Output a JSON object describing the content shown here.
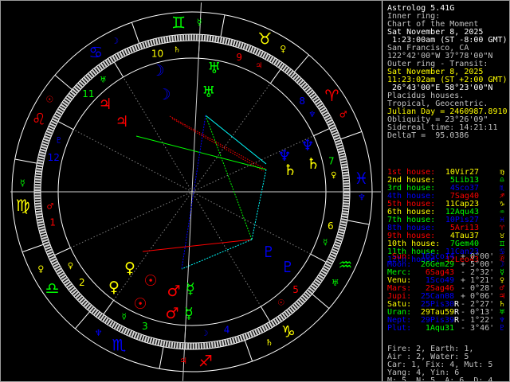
{
  "info": [
    {
      "text": "Astrolog 5.41G",
      "color": "#ffffff"
    },
    {
      "text": "Inner ring:",
      "color": "#c0c0c0"
    },
    {
      "text": "Chart of the Moment",
      "color": "#c0c0c0"
    },
    {
      "text": "Sat November 8, 2025",
      "color": "#ffffff"
    },
    {
      "text": " 1:23:00am (ST -8:00 GMT)",
      "color": "#ffffff"
    },
    {
      "text": "San Francisco, CA",
      "color": "#c0c0c0"
    },
    {
      "text": "122°42'00\"W 37°78'00\"N",
      "color": "#c0c0c0"
    },
    {
      "text": "Outer ring - Transit:",
      "color": "#c0c0c0"
    },
    {
      "text": "Sat November 8, 2025",
      "color": "#ffff00"
    },
    {
      "text": "11:23:02am (ST +2:00 GMT)",
      "color": "#ffff00"
    },
    {
      "text": " 26°43'00\"E 58°23'00\"N",
      "color": "#ffffff"
    },
    {
      "text": "Placidus houses.",
      "color": "#c0c0c0"
    },
    {
      "text": "Tropical, Geocentric.",
      "color": "#c0c0c0"
    },
    {
      "text": "Julian Day = 2460987.8910",
      "color": "#ffff00"
    },
    {
      "text": "Obliquity = 23°26'09\"",
      "color": "#c0c0c0"
    },
    {
      "text": "Sidereal time: 14:21:11",
      "color": "#c0c0c0"
    },
    {
      "text": "DeltaT =  95.0386",
      "color": "#c0c0c0"
    }
  ],
  "houses": [
    {
      "label": "1st house:",
      "value": "10Vir27",
      "glyph": "♍",
      "house_color": "#ff0000",
      "sign_color": "#ffff00"
    },
    {
      "label": "2nd house:",
      "value": "5Lib13",
      "glyph": "♎",
      "house_color": "#ffff00",
      "sign_color": "#00ff00"
    },
    {
      "label": "3rd house:",
      "value": "4Sco37",
      "glyph": "♏",
      "house_color": "#00ff00",
      "sign_color": "#0000ff"
    },
    {
      "label": "4th house:",
      "value": "7Sag40",
      "glyph": "♐",
      "house_color": "#0000ff",
      "sign_color": "#ff0000"
    },
    {
      "label": "5th house:",
      "value": "11Cap23",
      "glyph": "♑",
      "house_color": "#ff0000",
      "sign_color": "#ffff00"
    },
    {
      "label": "6th house:",
      "value": "12Aqu43",
      "glyph": "♒",
      "house_color": "#ffff00",
      "sign_color": "#00ff00"
    },
    {
      "label": "7th house:",
      "value": "10Pis27",
      "glyph": "♓",
      "house_color": "#00ff00",
      "sign_color": "#0000ff"
    },
    {
      "label": "8th house:",
      "value": "5Ari13",
      "glyph": "♈",
      "house_color": "#0000ff",
      "sign_color": "#ff0000"
    },
    {
      "label": "9th house:",
      "value": "4Tau37",
      "glyph": "♉",
      "house_color": "#ff0000",
      "sign_color": "#ffff00"
    },
    {
      "label": "10th house:",
      "value": "7Gem40",
      "glyph": "♊",
      "house_color": "#ffff00",
      "sign_color": "#00ff00"
    },
    {
      "label": "11th house:",
      "value": "11Can23",
      "glyph": "♋",
      "house_color": "#00ff00",
      "sign_color": "#0000ff"
    },
    {
      "label": "12th house:",
      "value": "12Leo43",
      "glyph": "♌",
      "house_color": "#0000ff",
      "sign_color": "#ff0000"
    }
  ],
  "planets": [
    {
      "name": "Sun:",
      "value": "16Sco14",
      "retro": "",
      "aspect": "+ 0°00'",
      "glyph": "☉",
      "color": "#ff0000",
      "sign_color": "#0000ff"
    },
    {
      "name": "Moon:",
      "value": "26Gem29",
      "retro": "",
      "aspect": "+ 5°00'",
      "glyph": "☽",
      "color": "#0000ff",
      "sign_color": "#00ff00"
    },
    {
      "name": "Merc:",
      "value": "6Sag43",
      "retro": "",
      "aspect": "- 2°32'",
      "glyph": "☿",
      "color": "#00ff00",
      "sign_color": "#ff0000"
    },
    {
      "name": "Venu:",
      "value": "1Sco49",
      "retro": "",
      "aspect": "+ 1°21'",
      "glyph": "♀",
      "color": "#ffff00",
      "sign_color": "#0000ff"
    },
    {
      "name": "Mars:",
      "value": "2Sag46",
      "retro": "",
      "aspect": "- 0°28'",
      "glyph": "♂",
      "color": "#ff0000",
      "sign_color": "#ff0000"
    },
    {
      "name": "Jupi:",
      "value": "25Can08",
      "retro": "",
      "aspect": "+ 0°06'",
      "glyph": "♃",
      "color": "#ff0000",
      "sign_color": "#0000ff"
    },
    {
      "name": "Satu:",
      "value": "25Pis30",
      "retro": "R",
      "aspect": "- 2°27'",
      "glyph": "♄",
      "color": "#ffff00",
      "sign_color": "#0000ff"
    },
    {
      "name": "Uran:",
      "value": "29Tau59",
      "retro": "R",
      "aspect": "- 0°13'",
      "glyph": "♅",
      "color": "#00ff00",
      "sign_color": "#ffff00"
    },
    {
      "name": "Nept:",
      "value": "29Pis39",
      "retro": "R",
      "aspect": "- 1°22'",
      "glyph": "♆",
      "color": "#0000ff",
      "sign_color": "#0000ff"
    },
    {
      "name": "Plut:",
      "value": "1Aqu31",
      "retro": "",
      "aspect": "- 3°46'",
      "glyph": "♇",
      "color": "#0000ff",
      "sign_color": "#00ff00"
    }
  ],
  "elements": [
    "Fire: 2, Earth: 1,",
    "Air : 2, Water: 5",
    "Car: 1, Fix: 4, Mut: 5",
    "Yang: 4, Yin: 6",
    "M: 5, N: 5, A: 6, D: 4"
  ],
  "chart_data": {
    "type": "astrology-biwheel",
    "ascendant_deg": 160.45,
    "house_cusps_deg": [
      160.45,
      185.22,
      214.62,
      247.67,
      281.38,
      312.72,
      340.45,
      5.22,
      34.62,
      67.67,
      101.38,
      132.72
    ],
    "house_numbers": [
      "1",
      "2",
      "3",
      "4",
      "5",
      "6",
      "7",
      "8",
      "9",
      "10",
      "11",
      "12"
    ],
    "house_number_colors": [
      "#ff0000",
      "#ffff00",
      "#00ff00",
      "#0000ff",
      "#ff0000",
      "#ffff00",
      "#00ff00",
      "#0000ff",
      "#ff0000",
      "#ffff00",
      "#00ff00",
      "#0000ff"
    ],
    "signs": [
      {
        "glyph": "♈",
        "color": "#ff0000"
      },
      {
        "glyph": "♉",
        "color": "#ffff00"
      },
      {
        "glyph": "♊",
        "color": "#00ff00"
      },
      {
        "glyph": "♋",
        "color": "#0000ff"
      },
      {
        "glyph": "♌",
        "color": "#ff0000"
      },
      {
        "glyph": "♍",
        "color": "#ffff00"
      },
      {
        "glyph": "♎",
        "color": "#00ff00"
      },
      {
        "glyph": "♏",
        "color": "#0000ff"
      },
      {
        "glyph": "♐",
        "color": "#ff0000"
      },
      {
        "glyph": "♑",
        "color": "#ffff00"
      },
      {
        "glyph": "♒",
        "color": "#00ff00"
      },
      {
        "glyph": "♓",
        "color": "#0000ff"
      }
    ],
    "outer_markers": [
      {
        "glyph": "☿",
        "deg": 68,
        "color": "#00ff00"
      },
      {
        "glyph": "♀",
        "deg": 38,
        "color": "#ffff00"
      },
      {
        "glyph": "☽",
        "deg": 97.5,
        "color": "#0000ff"
      },
      {
        "glyph": "☉",
        "deg": 127.5,
        "color": "#ff0000"
      },
      {
        "glyph": "♂",
        "deg": 7.5,
        "color": "#ff0000"
      },
      {
        "glyph": "☿",
        "deg": 157.5,
        "color": "#00ff00"
      },
      {
        "glyph": "♀",
        "deg": 187.5,
        "color": "#ffff00"
      },
      {
        "glyph": "♆",
        "deg": 217,
        "color": "#0000ff"
      },
      {
        "glyph": "♃",
        "deg": 247.5,
        "color": "#ff0000"
      },
      {
        "glyph": "♄",
        "deg": 277.5,
        "color": "#ffff00"
      },
      {
        "glyph": "♅",
        "deg": 308,
        "color": "#00ff00"
      },
      {
        "glyph": "♆",
        "deg": 338.5,
        "color": "#0000ff"
      }
    ],
    "inner_markers": [
      {
        "glyph": "♄",
        "deg": 76.5,
        "color": "#ffff00"
      },
      {
        "glyph": "♃",
        "deg": 42.5,
        "color": "#ff0000"
      },
      {
        "glyph": "♅",
        "deg": 109,
        "color": "#00ff00"
      },
      {
        "glyph": "♇",
        "deg": 139.5,
        "color": "#0000ff"
      },
      {
        "glyph": "♂",
        "deg": 166.5,
        "color": "#ff0000"
      },
      {
        "glyph": "♀",
        "deg": 192,
        "color": "#ffff00"
      },
      {
        "glyph": "☿",
        "deg": 222,
        "color": "#00ff00"
      },
      {
        "glyph": "☽",
        "deg": 255.5,
        "color": "#0000ff"
      },
      {
        "glyph": "☉",
        "deg": 289,
        "color": "#ff0000"
      },
      {
        "glyph": "☿",
        "deg": 319.5,
        "color": "#00ff00"
      },
      {
        "glyph": "♀",
        "deg": 347,
        "color": "#ffff00"
      },
      {
        "glyph": "♆",
        "deg": 13,
        "color": "#0000ff"
      }
    ]
  }
}
